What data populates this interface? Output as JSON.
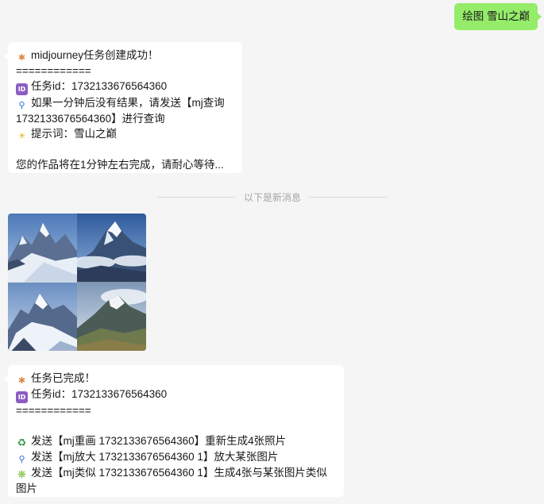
{
  "sent_message": {
    "text": "绘图 雪山之巅"
  },
  "task_created_message": {
    "lines": [
      {
        "icon": "party-popper-icon",
        "text": "midjourney任务创建成功！"
      },
      {
        "icon": "",
        "text": "============"
      },
      {
        "icon": "id-icon",
        "text": "任务id：1732133676564360"
      },
      {
        "icon": "magnifier-icon",
        "text": "如果一分钟后没有结果，请发送【mj查询1732133676564360】进行查询"
      },
      {
        "icon": "light-bulb-icon",
        "text": "提示词：雪山之巅"
      },
      {
        "icon": "",
        "text": ""
      },
      {
        "icon": "",
        "text": "您的作品将在1分钟左右完成，请耐心等待..."
      }
    ]
  },
  "divider": {
    "text": "以下是新消息"
  },
  "image_grid": {
    "tiles": [
      {
        "name": "snow-mountain-image-1"
      },
      {
        "name": "snow-mountain-image-2"
      },
      {
        "name": "snow-mountain-image-3"
      },
      {
        "name": "snow-mountain-image-4"
      }
    ]
  },
  "task_done_message": {
    "lines": [
      {
        "icon": "party-popper-icon",
        "text": "任务已完成！"
      },
      {
        "icon": "id-icon",
        "text": "任务id：1732133676564360"
      },
      {
        "icon": "",
        "text": "============"
      },
      {
        "icon": "",
        "text": ""
      },
      {
        "icon": "recycle-icon",
        "text": "发送【mj重画 1732133676564360】重新生成4张照片"
      },
      {
        "icon": "magnifier-icon",
        "text": "发送【mj放大 1732133676564360 1】放大某张图片"
      },
      {
        "icon": "puzzle-icon",
        "text": "发送【mj类似 1732133676564360 1】生成4张与某张图片类似图片"
      }
    ]
  },
  "colors": {
    "background": "#f5f5f5",
    "sent_bubble": "#95ec69",
    "received_bubble": "#ffffff"
  }
}
